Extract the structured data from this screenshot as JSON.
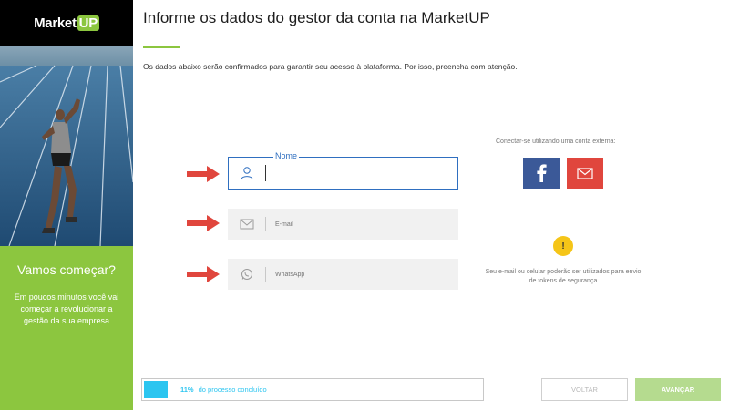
{
  "brand": {
    "logo_text": "Market",
    "logo_accent": "UP",
    "green": "#8cc63f"
  },
  "sidebar": {
    "heading": "Vamos começar?",
    "text": "Em poucos minutos você vai começar a revolucionar a gestão da sua empresa"
  },
  "header": {
    "title": "Informe os dados do gestor da conta na MarketUP",
    "subtitle": "Os dados abaixo serão confirmados para garantir seu acesso à plataforma. Por isso, preencha com atenção."
  },
  "form": {
    "name": {
      "label": "Nome",
      "value": "",
      "icon": "user-icon"
    },
    "email": {
      "placeholder": "E-mail",
      "icon": "envelope-icon"
    },
    "whatsapp": {
      "placeholder": "WhatsApp",
      "icon": "whatsapp-icon"
    }
  },
  "external": {
    "label": "Conectar-se utilizando uma conta externa:",
    "facebook": {
      "icon": "facebook-icon",
      "color": "#3b5998"
    },
    "email": {
      "icon": "envelope-icon",
      "color": "#e0463d"
    }
  },
  "notice": {
    "icon": "warning-icon",
    "symbol": "!",
    "text": "Seu e-mail ou celular poderão ser utilizados para envio de tokens de segurança"
  },
  "progress": {
    "percent_label": "11%",
    "text": "do processo concluído",
    "value": 0.11,
    "color": "#2cc5f0"
  },
  "buttons": {
    "back": "VOLTAR",
    "next": "AVANÇAR"
  }
}
